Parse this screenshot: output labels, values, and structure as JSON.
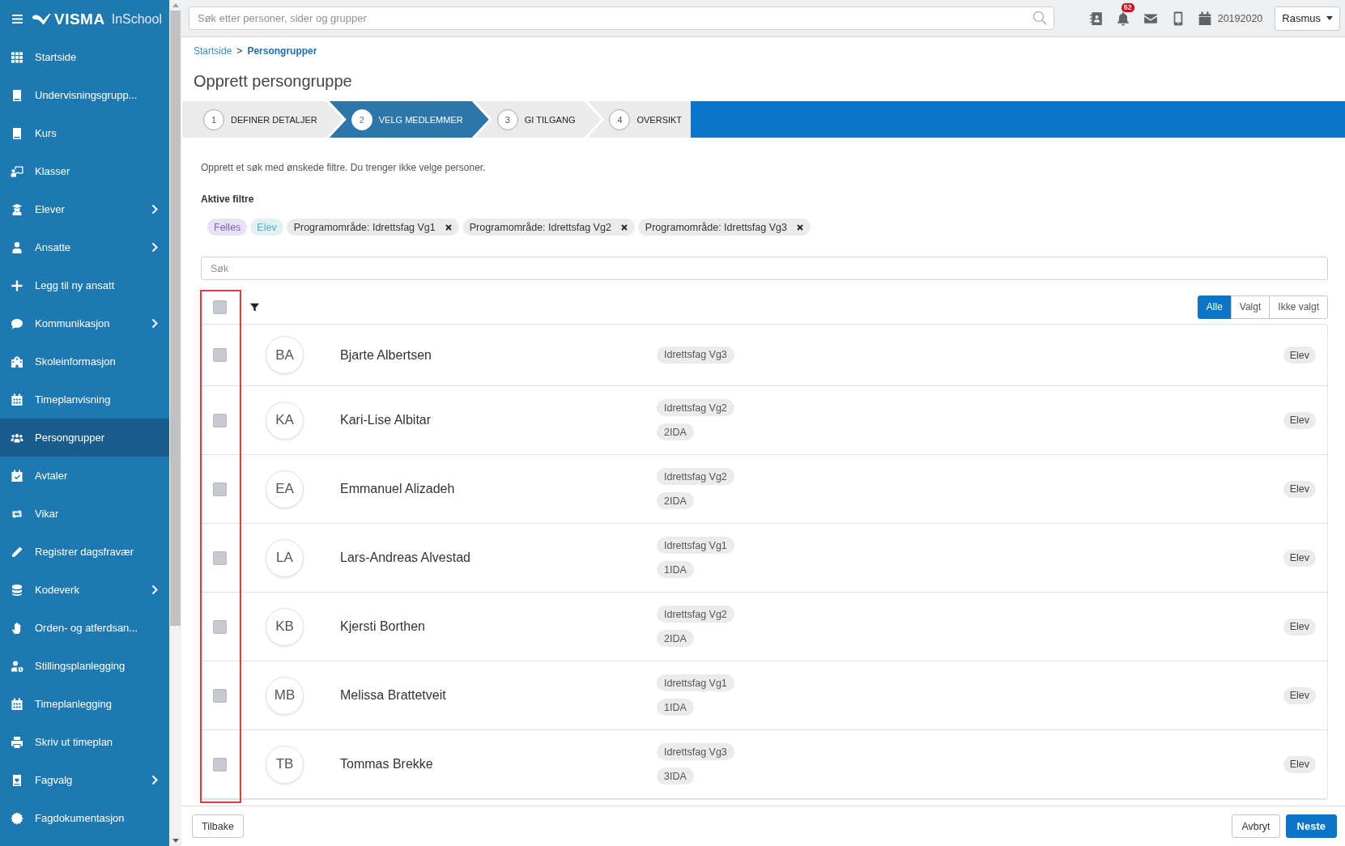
{
  "sidebar": {
    "logo": {
      "brand": "VISMA",
      "product": "InSchool"
    },
    "items": [
      {
        "label": "Startside",
        "selected": false,
        "has_submenu": false
      },
      {
        "label": "Undervisningsgrupp...",
        "selected": false,
        "has_submenu": false
      },
      {
        "label": "Kurs",
        "selected": false,
        "has_submenu": false
      },
      {
        "label": "Klasser",
        "selected": false,
        "has_submenu": false
      },
      {
        "label": "Elever",
        "selected": false,
        "has_submenu": true
      },
      {
        "label": "Ansatte",
        "selected": false,
        "has_submenu": true
      },
      {
        "label": "Legg til ny ansatt",
        "selected": false,
        "has_submenu": false
      },
      {
        "label": "Kommunikasjon",
        "selected": false,
        "has_submenu": true
      },
      {
        "label": "Skoleinformasjon",
        "selected": false,
        "has_submenu": false
      },
      {
        "label": "Timeplanvisning",
        "selected": false,
        "has_submenu": false
      },
      {
        "label": "Persongrupper",
        "selected": true,
        "has_submenu": false
      },
      {
        "label": "Avtaler",
        "selected": false,
        "has_submenu": false
      },
      {
        "label": "Vikar",
        "selected": false,
        "has_submenu": false
      },
      {
        "label": "Registrer dagsfravær",
        "selected": false,
        "has_submenu": false
      },
      {
        "label": "Kodeverk",
        "selected": false,
        "has_submenu": true
      },
      {
        "label": "Orden- og atferdsan...",
        "selected": false,
        "has_submenu": false
      },
      {
        "label": "Stillingsplanlegging",
        "selected": false,
        "has_submenu": false
      },
      {
        "label": "Timeplanlegging",
        "selected": false,
        "has_submenu": false
      },
      {
        "label": "Skriv ut timeplan",
        "selected": false,
        "has_submenu": false
      },
      {
        "label": "Fagvalg",
        "selected": false,
        "has_submenu": true
      },
      {
        "label": "Fagdokumentasjon",
        "selected": false,
        "has_submenu": false
      }
    ]
  },
  "topbar": {
    "search": {
      "placeholder": "Søk etter personer, sider og grupper"
    },
    "notification_count": "52",
    "school_year": "20192020",
    "user": "Rasmus"
  },
  "breadcrumb": {
    "items": [
      "Startside",
      "Persongrupper"
    ],
    "separator": ">"
  },
  "title": "Opprett persongruppe",
  "steps": [
    {
      "number": "1",
      "label": "DEFINER DETALJER",
      "selected": false
    },
    {
      "number": "2",
      "label": "VELG MEDLEMMER",
      "selected": true
    },
    {
      "number": "3",
      "label": "GI TILGANG",
      "selected": false
    },
    {
      "number": "4",
      "label": "OVERSIKT",
      "selected": false
    }
  ],
  "description": "Opprett et søk med ønskede filtre. Du trenger ikke velge personer.",
  "active_filters": {
    "label": "Aktive filtre",
    "chips": [
      {
        "label": "Felles",
        "kind": "tag",
        "color": "#7c5fc4"
      },
      {
        "label": "Elev",
        "kind": "tag",
        "color": "#52aebb"
      },
      {
        "label": "Programområde: Idrettsfag Vg1",
        "kind": "removable"
      },
      {
        "label": "Programområde: Idrettsfag Vg2",
        "kind": "removable"
      },
      {
        "label": "Programområde: Idrettsfag Vg3",
        "kind": "removable"
      }
    ]
  },
  "search": {
    "placeholder": "Søk"
  },
  "list": {
    "select_all_checked": false,
    "view_toggle": [
      {
        "label": "Alle",
        "selected": true
      },
      {
        "label": "Valgt",
        "selected": false
      },
      {
        "label": "Ikke valgt",
        "selected": false
      }
    ],
    "rows": [
      {
        "checked": false,
        "initials": "BA",
        "name": "Bjarte Albertsen",
        "tags": [
          "Idrettsfag Vg3"
        ],
        "role": "Elev"
      },
      {
        "checked": false,
        "initials": "KA",
        "name": "Kari-Lise Albitar",
        "tags": [
          "Idrettsfag Vg2",
          "2IDA"
        ],
        "role": "Elev"
      },
      {
        "checked": false,
        "initials": "EA",
        "name": "Emmanuel Alizadeh",
        "tags": [
          "Idrettsfag Vg2",
          "2IDA"
        ],
        "role": "Elev"
      },
      {
        "checked": false,
        "initials": "LA",
        "name": "Lars-Andreas Alvestad",
        "tags": [
          "Idrettsfag Vg1",
          "1IDA"
        ],
        "role": "Elev"
      },
      {
        "checked": false,
        "initials": "KB",
        "name": "Kjersti Borthen",
        "tags": [
          "Idrettsfag Vg2",
          "2IDA"
        ],
        "role": "Elev"
      },
      {
        "checked": false,
        "initials": "MB",
        "name": "Melissa Brattetveit",
        "tags": [
          "Idrettsfag Vg1",
          "1IDA"
        ],
        "role": "Elev"
      },
      {
        "checked": false,
        "initials": "TB",
        "name": "Tommas Brekke",
        "tags": [
          "Idrettsfag Vg3",
          "3IDA"
        ],
        "role": "Elev"
      }
    ]
  },
  "footer": {
    "left_buttons": [
      {
        "label": "Tilbake",
        "kind": "default"
      }
    ],
    "right_buttons": [
      {
        "label": "Avbryt",
        "kind": "default"
      },
      {
        "label": "Neste",
        "kind": "primary"
      }
    ]
  }
}
